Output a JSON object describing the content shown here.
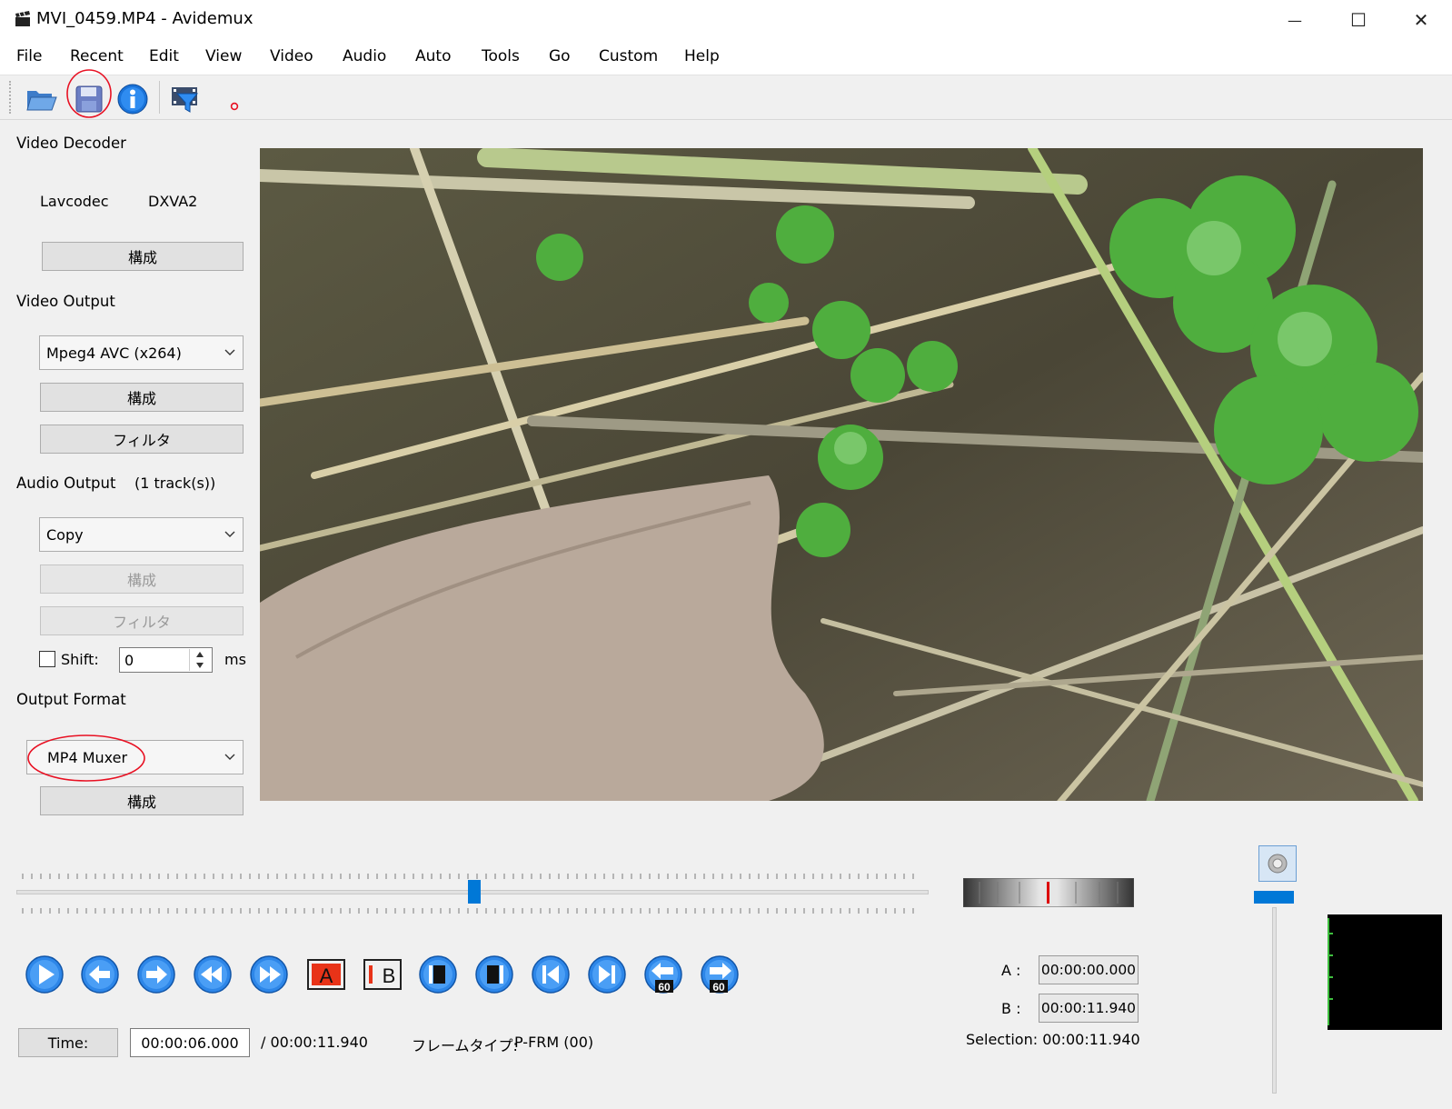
{
  "window": {
    "title": "MVI_0459.MP4 - Avidemux",
    "minimize_glyph": "—",
    "maximize_glyph": "☐",
    "close_glyph": "✕"
  },
  "menu": [
    "File",
    "Recent",
    "Edit",
    "View",
    "Video",
    "Audio",
    "Auto",
    "Tools",
    "Go",
    "Custom",
    "Help"
  ],
  "toolbar": {
    "icons": [
      "open-folder-icon",
      "save-floppy-icon",
      "info-icon",
      "video-filter-icon"
    ],
    "highlight_color": "#e81123"
  },
  "video_decoder": {
    "title": "Video Decoder",
    "decoder": "Lavcodec",
    "hw": "DXVA2",
    "configure": "構成"
  },
  "video_output": {
    "title": "Video Output",
    "codec": "Mpeg4 AVC (x264)",
    "configure": "構成",
    "filters": "フィルタ"
  },
  "audio_output": {
    "title": "Audio Output",
    "tracks": "(1 track(s))",
    "codec": "Copy",
    "configure": "構成",
    "filters": "フィルタ",
    "shift_label": "Shift:",
    "shift_value": "0",
    "shift_unit": "ms"
  },
  "output_format": {
    "title": "Output Format",
    "muxer": "MP4 Muxer",
    "configure": "構成"
  },
  "timeline": {
    "position_fraction": 0.5025,
    "accent": "#0078d7"
  },
  "player_buttons": [
    "play-icon",
    "previous-frame-icon",
    "next-frame-icon",
    "rewind-icon",
    "fast-forward-icon",
    "marker-a-icon",
    "marker-b-icon",
    "go-to-marker-a-icon",
    "go-to-marker-b-icon",
    "previous-keyframe-icon",
    "next-keyframe-icon",
    "back-one-minute-icon",
    "forward-one-minute-icon"
  ],
  "marker_a_glyph": "A",
  "marker_b_glyph": "B",
  "minute_glyph": "60",
  "time": {
    "button": "Time:",
    "current": "00:00:06.000",
    "total": "/ 00:00:11.940",
    "frame_type_label": "フレームタイプ:",
    "frame_type": "P-FRM (00)"
  },
  "selection": {
    "a_label": "A :",
    "a_value": "00:00:00.000",
    "b_label": "B :",
    "b_value": "00:00:11.940",
    "selection_text": "Selection: 00:00:11.940"
  },
  "volume": {
    "level_fraction": 1.0
  }
}
